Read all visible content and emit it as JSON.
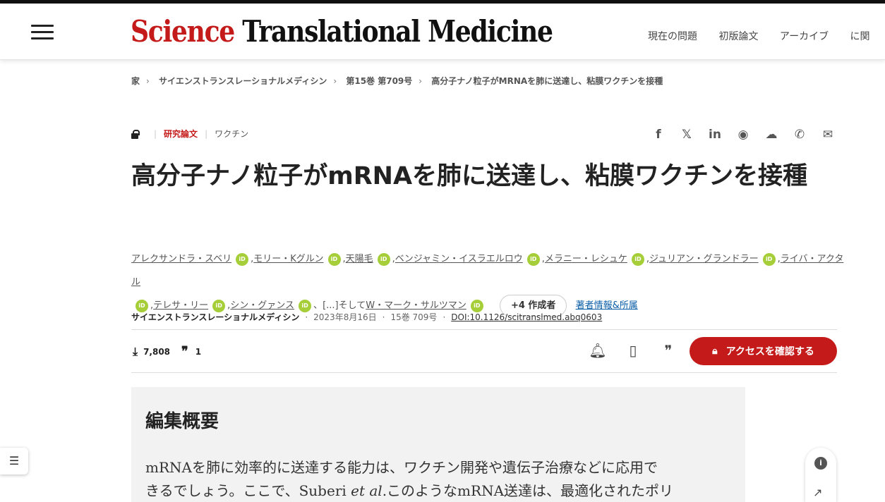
{
  "header": {
    "logo_science": "Science",
    "logo_rest": " Translational Medicine",
    "nav": [
      "現在の問題",
      "初版論文",
      "アーカイブ",
      "に関"
    ]
  },
  "breadcrumb": [
    "家",
    "サイエンストランスレーショナルメディシン",
    "第15巻 第709号",
    "高分子ナノ粒子がMRNAを肺に送達し、粘膜ワクチンを接種"
  ],
  "article": {
    "type": "研究論文",
    "subject": "ワクチン",
    "title": "高分子ナノ粒子がmRNAを肺に送達し、粘膜ワクチンを接種",
    "authors": [
      "アレクサンドラ・スベリ",
      "モリー・Kグルン",
      "天陽毛",
      "ベンジャミン・イスラエルロウ",
      "メラニー・レシュケ",
      "ジュリアン・グランドラー",
      "ライバ・アクタル",
      "テレサ・リー",
      "シン・グァンス"
    ],
    "authors_mid": "[...]そして",
    "last_author": "W・マーク・サルツマン",
    "more_authors": "+4 作成者",
    "affiliations": "著者情報&所属",
    "journal": "サイエンストランスレーショナルメディシン",
    "date": "2023年8月16日",
    "issue": "15巻 709号",
    "doi": "DOI:10.1126/scitranslmed.abq0603"
  },
  "metrics": {
    "downloads": "7,808",
    "citations": "1"
  },
  "access_button": "アクセスを確認する",
  "editor_summary": {
    "heading": "編集概要",
    "text_line1": "mRNAを肺に効率的に送達する能力は、ワクチン開発や遺伝子治療などに応用で",
    "text_line2_a": "きるでしょう。ここで、Suberi ",
    "text_line2_b": "et al",
    "text_line2_c": ".このようなmRNA送達は、最適化されたポリ"
  },
  "icons": [
    "menu-icon",
    "lock-icon",
    "facebook-icon",
    "x-icon",
    "linkedin-icon",
    "reddit-icon",
    "wechat-icon",
    "whatsapp-icon",
    "email-icon",
    "download-icon",
    "quote-icon",
    "bell-icon",
    "bookmark-icon",
    "cite-icon",
    "toc-icon",
    "info-icon",
    "trend-icon"
  ],
  "colors": {
    "brand_red": "#c41a1a",
    "orcid_green": "#a6ce39"
  }
}
